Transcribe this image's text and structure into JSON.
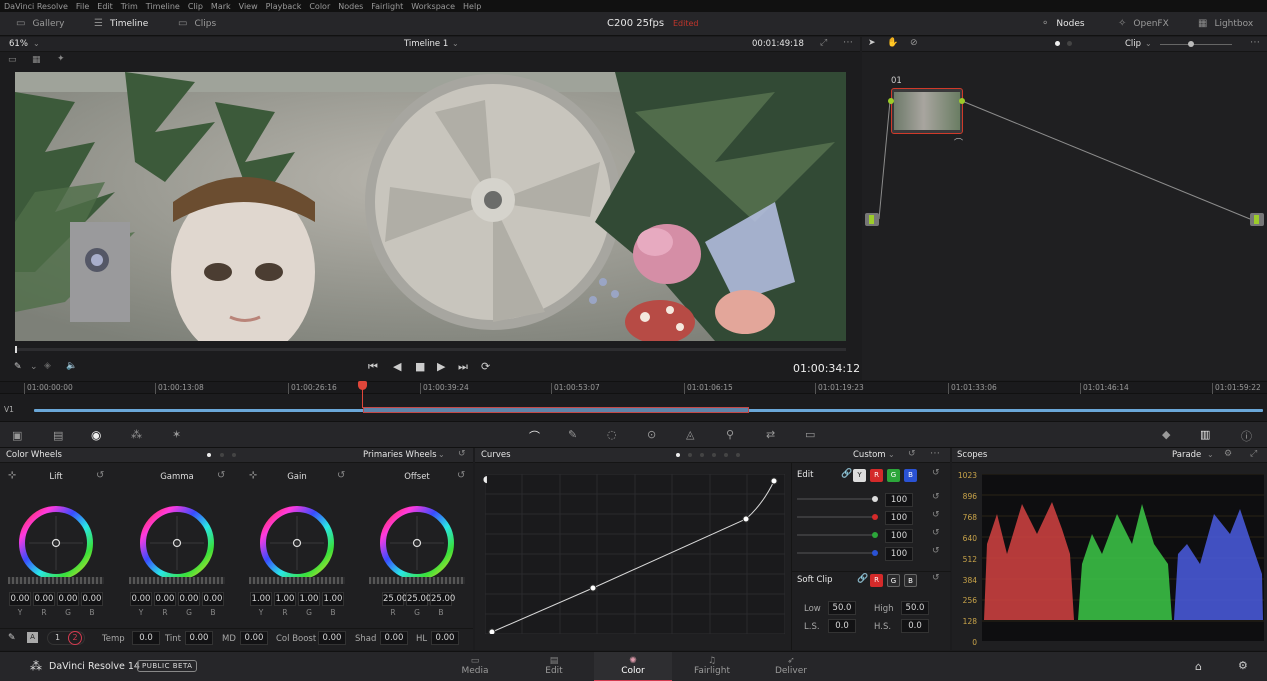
{
  "menu": {
    "items": [
      "DaVinci Resolve",
      "File",
      "Edit",
      "Trim",
      "Timeline",
      "Clip",
      "Mark",
      "View",
      "Playback",
      "Color",
      "Nodes",
      "Fairlight",
      "Workspace",
      "Help"
    ]
  },
  "header": {
    "gallery": "Gallery",
    "timeline": "Timeline",
    "clips": "Clips",
    "project": "C200 25fps",
    "status": "Edited",
    "nodes": "Nodes",
    "openfx": "OpenFX",
    "lightbox": "Lightbox"
  },
  "viewer": {
    "zoom": "61%",
    "timeline_name": "Timeline 1",
    "timecode_top": "00:01:49:18",
    "timecode_current": "01:00:34:12"
  },
  "node_editor": {
    "mode": "Clip",
    "node_label": "01"
  },
  "timeline_ruler": {
    "ticks": [
      "01:00:00:00",
      "01:00:13:08",
      "01:00:26:16",
      "01:00:39:24",
      "01:00:53:07",
      "01:01:06:15",
      "01:01:19:23",
      "01:01:33:06",
      "01:01:46:14",
      "01:01:59:22"
    ],
    "track": "V1"
  },
  "color_wheels": {
    "title": "Color Wheels",
    "mode": "Primaries Wheels",
    "wheels": [
      {
        "name": "Lift",
        "values": [
          "0.00",
          "0.00",
          "0.00",
          "0.00"
        ]
      },
      {
        "name": "Gamma",
        "values": [
          "0.00",
          "0.00",
          "0.00",
          "0.00"
        ]
      },
      {
        "name": "Gain",
        "values": [
          "1.00",
          "1.00",
          "1.00",
          "1.00"
        ]
      },
      {
        "name": "Offset",
        "values": [
          "25.00",
          "25.00",
          "25.00"
        ]
      }
    ],
    "channels4": [
      "Y",
      "R",
      "G",
      "B"
    ],
    "channels3": [
      "R",
      "G",
      "B"
    ],
    "pages": [
      "1",
      "2"
    ],
    "params": [
      {
        "label": "Temp",
        "value": "0.0"
      },
      {
        "label": "Tint",
        "value": "0.00"
      },
      {
        "label": "MD",
        "value": "0.00"
      },
      {
        "label": "Col Boost",
        "value": "0.00"
      },
      {
        "label": "Shad",
        "value": "0.00"
      },
      {
        "label": "HL",
        "value": "0.00"
      }
    ]
  },
  "curves": {
    "title": "Curves",
    "mode": "Custom",
    "edit_label": "Edit",
    "intensity": [
      "100",
      "100",
      "100",
      "100"
    ],
    "soft_clip": "Soft Clip",
    "low_label": "Low",
    "low": "50.0",
    "high_label": "High",
    "high": "50.0",
    "ls_label": "L.S.",
    "ls": "0.0",
    "hs_label": "H.S.",
    "hs": "0.0"
  },
  "scopes": {
    "title": "Scopes",
    "mode": "Parade",
    "scale": [
      "1023",
      "896",
      "768",
      "640",
      "512",
      "384",
      "256",
      "128",
      "0"
    ]
  },
  "bottom": {
    "app": "DaVinci Resolve 14",
    "badge": "PUBLIC BETA",
    "tabs": [
      "Media",
      "Edit",
      "Color",
      "Fairlight",
      "Deliver"
    ]
  },
  "colors": {
    "accent": "#d43b50",
    "playhead": "#e0463a",
    "track": "#6aa7d8",
    "node_border": "#d03a2a",
    "node_port": "#9ccc2a"
  }
}
